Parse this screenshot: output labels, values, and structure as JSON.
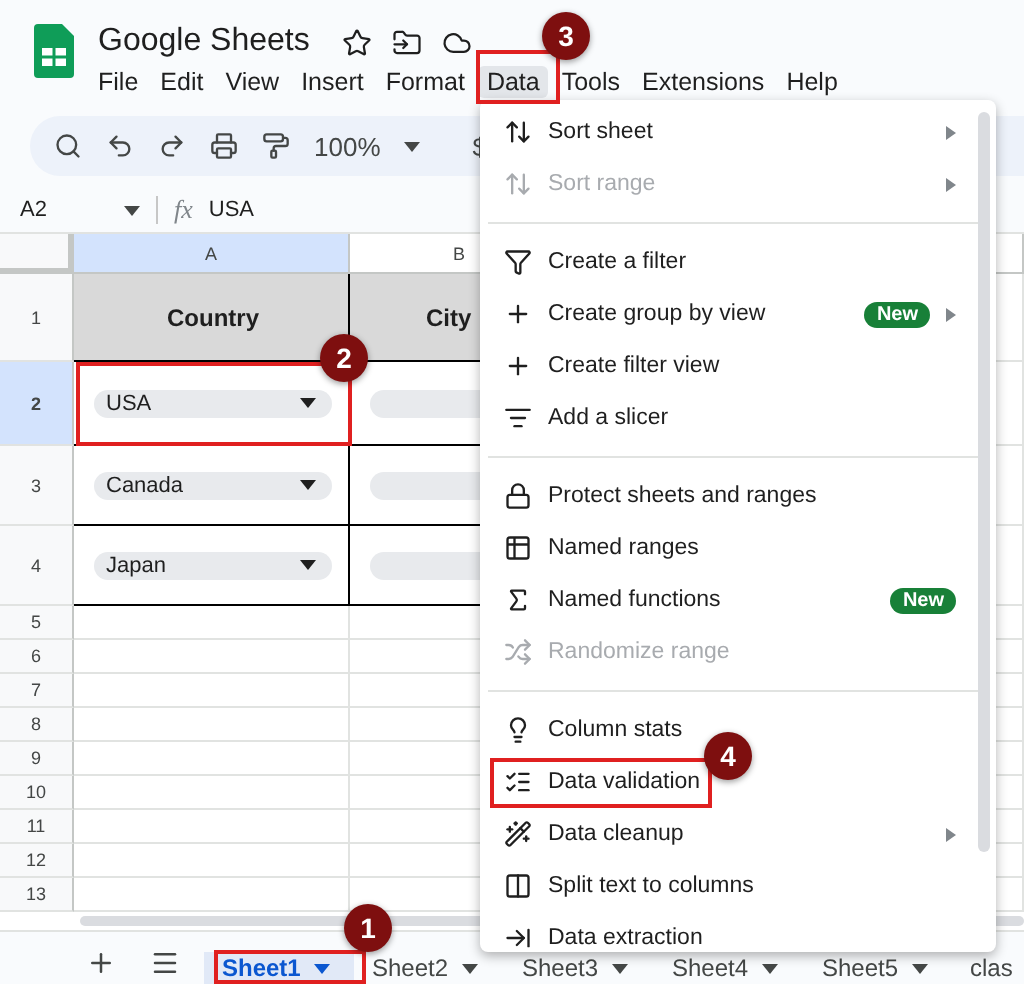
{
  "app": {
    "title": "Google Sheets"
  },
  "menu_bar": [
    {
      "label": "File",
      "selected": false
    },
    {
      "label": "Edit",
      "selected": false
    },
    {
      "label": "View",
      "selected": false
    },
    {
      "label": "Insert",
      "selected": false
    },
    {
      "label": "Format",
      "selected": false
    },
    {
      "label": "Data",
      "selected": true
    },
    {
      "label": "Tools",
      "selected": false
    },
    {
      "label": "Extensions",
      "selected": false
    },
    {
      "label": "Help",
      "selected": false
    }
  ],
  "toolbar": {
    "zoom": "100%",
    "currency": "$"
  },
  "formula_bar": {
    "cell_ref": "A2",
    "fx": "fx",
    "value": "USA"
  },
  "columns": [
    {
      "label": "A",
      "selected": true
    },
    {
      "label": "B",
      "selected": false
    }
  ],
  "rows": [
    {
      "number": "1",
      "selected": false,
      "cells": [
        {
          "kind": "header",
          "text": "Country"
        },
        {
          "kind": "header",
          "text": "City"
        }
      ]
    },
    {
      "number": "2",
      "selected": true,
      "cells": [
        {
          "kind": "dropdown",
          "text": "USA"
        },
        {
          "kind": "dropdown"
        }
      ]
    },
    {
      "number": "3",
      "selected": false,
      "cells": [
        {
          "kind": "dropdown",
          "text": "Canada"
        },
        {
          "kind": "dropdown"
        }
      ]
    },
    {
      "number": "4",
      "selected": false,
      "cells": [
        {
          "kind": "dropdown",
          "text": "Japan"
        },
        {
          "kind": "dropdown"
        }
      ]
    },
    {
      "number": "5",
      "selected": false
    },
    {
      "number": "6",
      "selected": false
    },
    {
      "number": "7",
      "selected": false
    },
    {
      "number": "8",
      "selected": false
    },
    {
      "number": "9",
      "selected": false
    },
    {
      "number": "10",
      "selected": false
    },
    {
      "number": "11",
      "selected": false
    },
    {
      "number": "12",
      "selected": false
    },
    {
      "number": "13",
      "selected": false
    }
  ],
  "sheet_tabs": [
    {
      "label": "Sheet1",
      "selected": true
    },
    {
      "label": "Sheet2",
      "selected": false
    },
    {
      "label": "Sheet3",
      "selected": false
    },
    {
      "label": "Sheet4",
      "selected": false
    },
    {
      "label": "Sheet5",
      "selected": false
    },
    {
      "label": "clas",
      "selected": false
    }
  ],
  "data_menu": {
    "sections": [
      [
        {
          "label": "Sort sheet",
          "disabled": false,
          "submenu": true
        },
        {
          "label": "Sort range",
          "disabled": true,
          "submenu": true
        }
      ],
      [
        {
          "label": "Create a filter",
          "disabled": false,
          "submenu": false
        },
        {
          "label": "Create group by view",
          "disabled": false,
          "submenu": true,
          "badge": "New"
        },
        {
          "label": "Create filter view",
          "disabled": false,
          "submenu": false
        },
        {
          "label": "Add a slicer",
          "disabled": false,
          "submenu": false
        }
      ],
      [
        {
          "label": "Protect sheets and ranges",
          "disabled": false,
          "submenu": false
        },
        {
          "label": "Named ranges",
          "disabled": false,
          "submenu": false
        },
        {
          "label": "Named functions",
          "disabled": false,
          "submenu": false,
          "badge": "New"
        },
        {
          "label": "Randomize range",
          "disabled": true,
          "submenu": false
        }
      ],
      [
        {
          "label": "Column stats",
          "disabled": false,
          "submenu": false
        },
        {
          "label": "Data validation",
          "disabled": false,
          "submenu": false
        },
        {
          "label": "Data cleanup",
          "disabled": false,
          "submenu": true
        },
        {
          "label": "Split text to columns",
          "disabled": false,
          "submenu": false
        },
        {
          "label": "Data extraction",
          "disabled": false,
          "submenu": false
        }
      ]
    ]
  },
  "callouts": [
    {
      "number": "1"
    },
    {
      "number": "2"
    },
    {
      "number": "3"
    },
    {
      "number": "4"
    }
  ]
}
